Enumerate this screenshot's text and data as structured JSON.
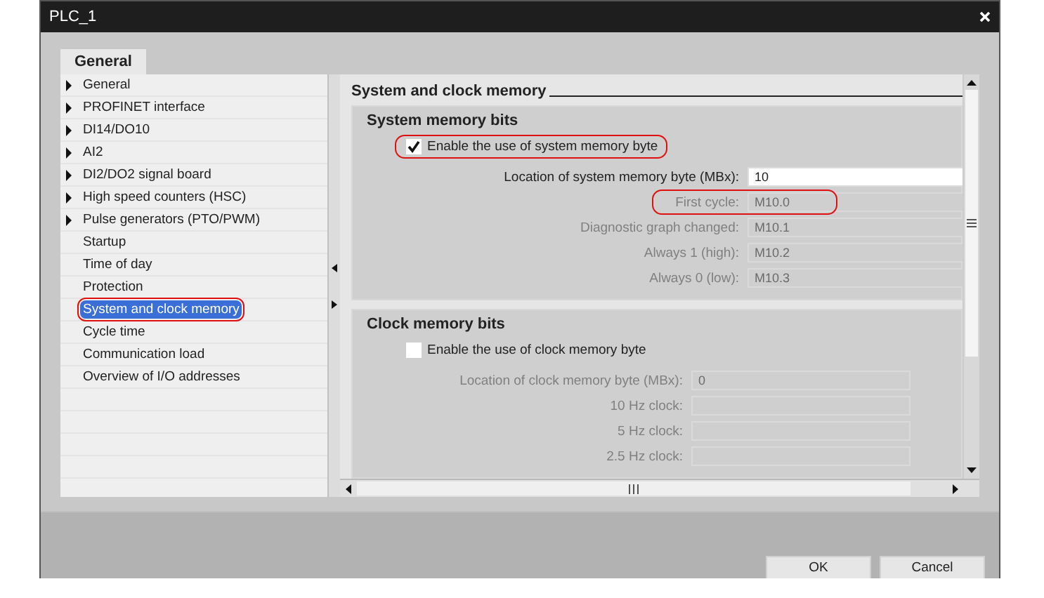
{
  "window": {
    "title": "PLC_1"
  },
  "tabs": [
    {
      "label": "General",
      "selected": true
    }
  ],
  "sidebar": {
    "items": [
      {
        "label": "General",
        "expandable": true,
        "selected": false,
        "highlighted": false
      },
      {
        "label": "PROFINET interface",
        "expandable": true,
        "selected": false,
        "highlighted": false
      },
      {
        "label": "DI14/DO10",
        "expandable": true,
        "selected": false,
        "highlighted": false
      },
      {
        "label": "AI2",
        "expandable": true,
        "selected": false,
        "highlighted": false
      },
      {
        "label": "DI2/DO2 signal board",
        "expandable": true,
        "selected": false,
        "highlighted": false
      },
      {
        "label": "High speed counters (HSC)",
        "expandable": true,
        "selected": false,
        "highlighted": false
      },
      {
        "label": "Pulse generators (PTO/PWM)",
        "expandable": true,
        "selected": false,
        "highlighted": false
      },
      {
        "label": "Startup",
        "expandable": false,
        "selected": false,
        "highlighted": false
      },
      {
        "label": "Time of day",
        "expandable": false,
        "selected": false,
        "highlighted": false
      },
      {
        "label": "Protection",
        "expandable": false,
        "selected": false,
        "highlighted": false
      },
      {
        "label": "System and clock memory",
        "expandable": false,
        "selected": true,
        "highlighted": true
      },
      {
        "label": "Cycle time",
        "expandable": false,
        "selected": false,
        "highlighted": false
      },
      {
        "label": "Communication load",
        "expandable": false,
        "selected": false,
        "highlighted": false
      },
      {
        "label": "Overview of I/O addresses",
        "expandable": false,
        "selected": false,
        "highlighted": false
      }
    ]
  },
  "content": {
    "title": "System and clock memory",
    "sections": [
      {
        "title": "System memory bits",
        "checkbox": {
          "label": "Enable the use of system memory byte",
          "checked": true,
          "highlighted": true
        },
        "fields": [
          {
            "label": "Location of system memory byte (MBx):",
            "value": "10",
            "disabled": false,
            "highlighted": false
          },
          {
            "label": "First cycle:",
            "value": "M10.0",
            "disabled": true,
            "highlighted": true
          },
          {
            "label": "Diagnostic graph changed:",
            "value": "M10.1",
            "disabled": true,
            "highlighted": false
          },
          {
            "label": "Always 1 (high):",
            "value": "M10.2",
            "disabled": true,
            "highlighted": false
          },
          {
            "label": "Always 0 (low):",
            "value": "M10.3",
            "disabled": true,
            "highlighted": false
          }
        ]
      },
      {
        "title": "Clock memory bits",
        "checkbox": {
          "label": "Enable the use of clock memory byte",
          "checked": false,
          "highlighted": false
        },
        "fields": [
          {
            "label": "Location of clock memory byte (MBx):",
            "value": "0",
            "disabled": true,
            "highlighted": false
          },
          {
            "label": "10 Hz clock:",
            "disabled": true,
            "highlighted": false
          },
          {
            "label": "5 Hz clock:",
            "disabled": true,
            "highlighted": false
          },
          {
            "label": "2.5 Hz clock:",
            "disabled": true,
            "highlighted": false
          }
        ]
      }
    ]
  },
  "buttons": [
    {
      "label": "OK"
    },
    {
      "label": "Cancel"
    }
  ]
}
